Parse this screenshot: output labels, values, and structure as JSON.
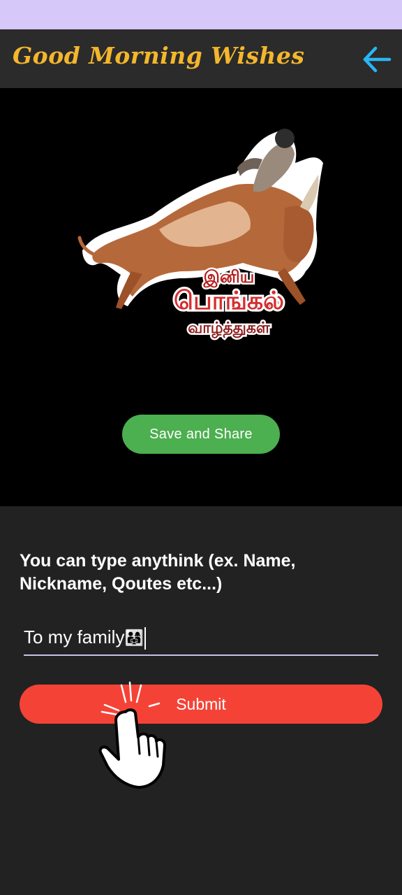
{
  "app_bar": {
    "title": "Good Morning Wishes",
    "back_icon": "arrow-left-icon",
    "back_color": "#29b6f6",
    "title_color": "#f4b62c"
  },
  "image_area": {
    "sticker_text_line1": "இனிய",
    "sticker_text_line2": "பொங்கல்",
    "sticker_text_line3": "வாழ்த்துகள்",
    "save_button_label": "Save and Share",
    "save_button_color": "#4caf50"
  },
  "form": {
    "prompt": "You can type anythink (ex. Name, Nickname, Qoutes etc...)",
    "input_value": "To my family",
    "input_emoji": "👨‍👩‍👧",
    "submit_label": "Submit",
    "submit_color": "#f44336",
    "pointer_icon": "hand-pointer-icon"
  }
}
